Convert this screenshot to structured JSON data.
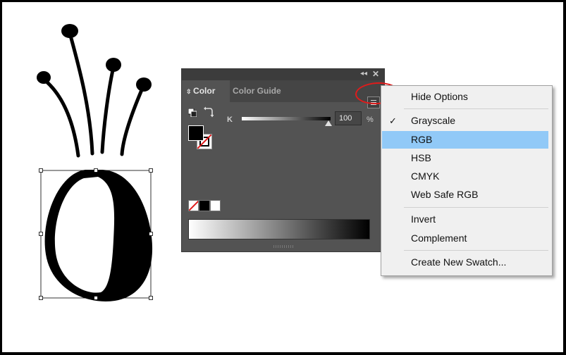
{
  "panel": {
    "tabs": [
      {
        "label": "Color",
        "active": true
      },
      {
        "label": "Color Guide",
        "active": false
      }
    ],
    "collapse_glyph": "◂◂",
    "close_glyph": "✕",
    "slider": {
      "channel": "K",
      "value": "100",
      "unit": "%"
    },
    "fill_color": "#000000",
    "stroke": "none"
  },
  "menu": {
    "items": [
      {
        "label": "Hide Options",
        "checked": false,
        "highlighted": false
      },
      {
        "label": "Grayscale",
        "checked": true,
        "highlighted": false
      },
      {
        "label": "RGB",
        "checked": false,
        "highlighted": true
      },
      {
        "label": "HSB",
        "checked": false,
        "highlighted": false
      },
      {
        "label": "CMYK",
        "checked": false,
        "highlighted": false
      },
      {
        "label": "Web Safe RGB",
        "checked": false,
        "highlighted": false
      },
      {
        "label": "Invert",
        "checked": false,
        "highlighted": false
      },
      {
        "label": "Complement",
        "checked": false,
        "highlighted": false
      },
      {
        "label": "Create New Swatch...",
        "checked": false,
        "highlighted": false
      }
    ],
    "check_glyph": "✓"
  },
  "colors": {
    "highlight": "#91c9f7",
    "annotation": "#e01b1b",
    "panel_bg": "#535353"
  }
}
